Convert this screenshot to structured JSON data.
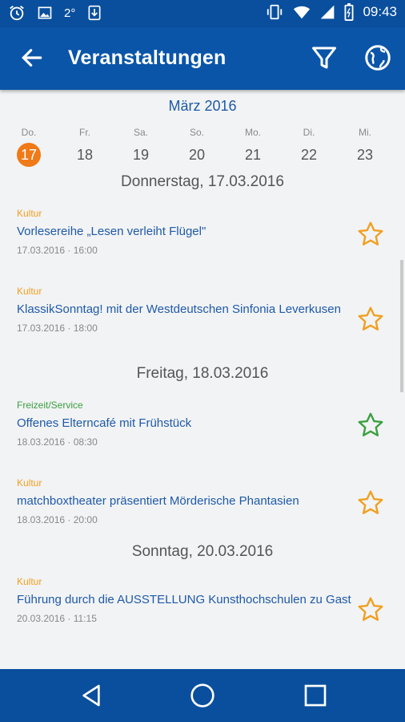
{
  "status_bar": {
    "time": "09:43",
    "left_icons": [
      "alarm-icon",
      "image-icon",
      "temperature-icon",
      "download-icon"
    ],
    "temperature": "2°",
    "right_icons": [
      "vibrate-icon",
      "wifi-icon",
      "signal-icon",
      "battery-icon"
    ]
  },
  "app_bar": {
    "title": "Veranstaltungen",
    "back_icon": "arrow-back-icon",
    "filter_icon": "filter-icon",
    "globe_icon": "globe-icon"
  },
  "calendar": {
    "month": "März 2016",
    "days": [
      {
        "dow": "Do.",
        "num": "17",
        "selected": true
      },
      {
        "dow": "Fr.",
        "num": "18",
        "selected": false
      },
      {
        "dow": "Sa.",
        "num": "19",
        "selected": false
      },
      {
        "dow": "So.",
        "num": "20",
        "selected": false
      },
      {
        "dow": "Mo.",
        "num": "21",
        "selected": false
      },
      {
        "dow": "Di.",
        "num": "22",
        "selected": false
      },
      {
        "dow": "Mi.",
        "num": "23",
        "selected": false
      }
    ]
  },
  "sections": [
    {
      "header": "Donnerstag, 17.03.2016",
      "events": [
        {
          "category": "Kultur",
          "title": "Vorlesereihe „Lesen verleiht Flügel\"",
          "time": "17.03.2016 · 16:00",
          "star_color": "#f0a020"
        },
        {
          "category": "Kultur",
          "title": "KlassikSonntag! mit der Westdeutschen Sinfonia Leverkusen",
          "time": "17.03.2016 · 18:00",
          "star_color": "#f0a020"
        }
      ]
    },
    {
      "header": "Freitag, 18.03.2016",
      "events": [
        {
          "category": "Freizeit/Service",
          "title": "Offenes Elterncafé mit Frühstück",
          "time": "18.03.2016 · 08:30",
          "star_color": "#3aa040"
        },
        {
          "category": "Kultur",
          "title": "matchboxtheater präsentiert Mörderische Phantasien",
          "time": "18.03.2016 · 20:00",
          "star_color": "#f0a020"
        }
      ]
    },
    {
      "header": "Sonntag, 20.03.2016",
      "events": [
        {
          "category": "Kultur",
          "title": "Führung durch die AUSSTELLUNG Kunsthochschulen zu Gast",
          "time": "20.03.2016 · 11:15",
          "star_color": "#f0a020"
        }
      ]
    }
  ],
  "nav_bar": {
    "back_icon": "nav-back-icon",
    "home_icon": "nav-home-icon",
    "recents_icon": "nav-recents-icon"
  },
  "colors": {
    "primary": "#0a55a8",
    "accent": "#f07a17",
    "link": "#1e5aa8",
    "kultur": "#f0a020",
    "freizeit": "#3aa040"
  }
}
